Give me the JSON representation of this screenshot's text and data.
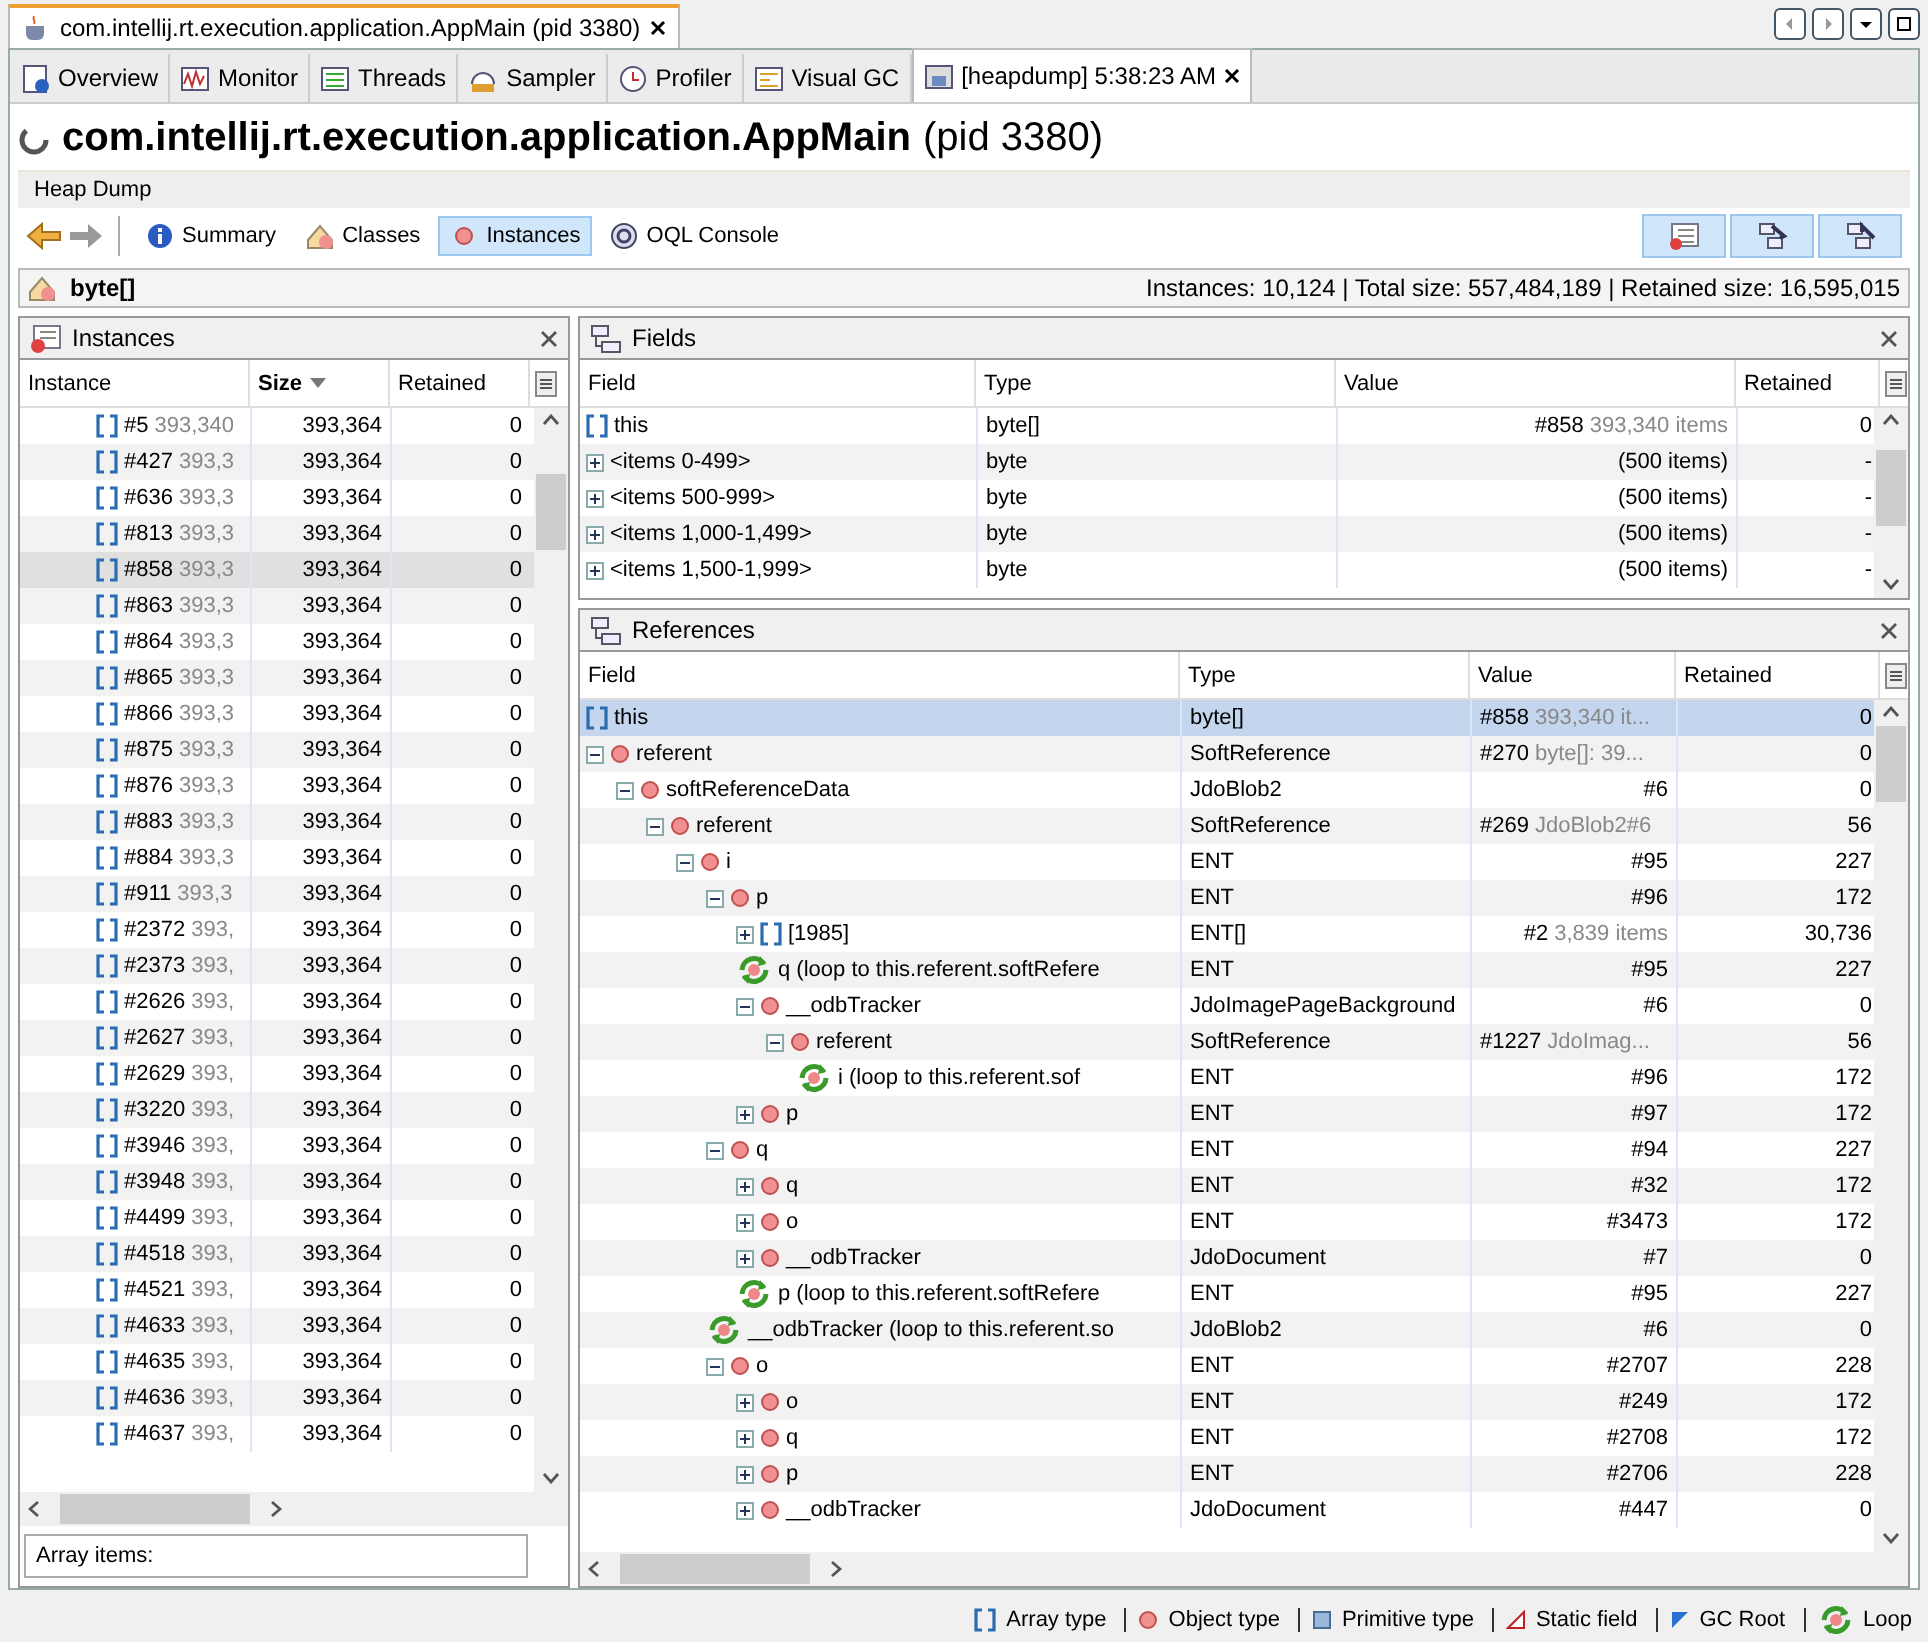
{
  "document_tab": {
    "title": "com.intellij.rt.execution.application.AppMain (pid 3380)",
    "selected": true
  },
  "tabs": [
    {
      "label": "Overview",
      "selected": false,
      "closable": false
    },
    {
      "label": "Monitor",
      "selected": false,
      "closable": false
    },
    {
      "label": "Threads",
      "selected": false,
      "closable": false
    },
    {
      "label": "Sampler",
      "selected": false,
      "closable": false
    },
    {
      "label": "Profiler",
      "selected": false,
      "closable": false
    },
    {
      "label": "Visual GC",
      "selected": false,
      "closable": false
    },
    {
      "label": "[heapdump] 5:38:23 AM",
      "selected": true,
      "closable": true
    }
  ],
  "heading": {
    "name": "com.intellij.rt.execution.application.AppMain",
    "pid": "(pid 3380)"
  },
  "view_label": "Heap Dump",
  "toolbar": [
    {
      "label": "Summary",
      "selected": false
    },
    {
      "label": "Classes",
      "selected": false
    },
    {
      "label": "Instances",
      "selected": true
    },
    {
      "label": "OQL Console",
      "selected": false
    }
  ],
  "class_bar": {
    "name": "byte[]",
    "stats": "Instances: 10,124  |  Total size: 557,484,189  |  Retained size: 16,595,015"
  },
  "instances": {
    "title": "Instances",
    "columns": [
      {
        "label": "Instance",
        "sorted": false
      },
      {
        "label": "Size",
        "sorted": true
      },
      {
        "label": "Retained",
        "sorted": false
      }
    ],
    "rows": [
      {
        "instance": "#5",
        "hint": "393,340",
        "size": "393,364",
        "retained": "0",
        "selected": false
      },
      {
        "instance": "#427",
        "hint": "393,3",
        "size": "393,364",
        "retained": "0",
        "selected": false
      },
      {
        "instance": "#636",
        "hint": "393,3",
        "size": "393,364",
        "retained": "0",
        "selected": false
      },
      {
        "instance": "#813",
        "hint": "393,3",
        "size": "393,364",
        "retained": "0",
        "selected": false
      },
      {
        "instance": "#858",
        "hint": "393,3",
        "size": "393,364",
        "retained": "0",
        "selected": true
      },
      {
        "instance": "#863",
        "hint": "393,3",
        "size": "393,364",
        "retained": "0",
        "selected": false
      },
      {
        "instance": "#864",
        "hint": "393,3",
        "size": "393,364",
        "retained": "0",
        "selected": false
      },
      {
        "instance": "#865",
        "hint": "393,3",
        "size": "393,364",
        "retained": "0",
        "selected": false
      },
      {
        "instance": "#866",
        "hint": "393,3",
        "size": "393,364",
        "retained": "0",
        "selected": false
      },
      {
        "instance": "#875",
        "hint": "393,3",
        "size": "393,364",
        "retained": "0",
        "selected": false
      },
      {
        "instance": "#876",
        "hint": "393,3",
        "size": "393,364",
        "retained": "0",
        "selected": false
      },
      {
        "instance": "#883",
        "hint": "393,3",
        "size": "393,364",
        "retained": "0",
        "selected": false
      },
      {
        "instance": "#884",
        "hint": "393,3",
        "size": "393,364",
        "retained": "0",
        "selected": false
      },
      {
        "instance": "#911",
        "hint": "393,3",
        "size": "393,364",
        "retained": "0",
        "selected": false
      },
      {
        "instance": "#2372",
        "hint": "393,",
        "size": "393,364",
        "retained": "0",
        "selected": false
      },
      {
        "instance": "#2373",
        "hint": "393,",
        "size": "393,364",
        "retained": "0",
        "selected": false
      },
      {
        "instance": "#2626",
        "hint": "393,",
        "size": "393,364",
        "retained": "0",
        "selected": false
      },
      {
        "instance": "#2627",
        "hint": "393,",
        "size": "393,364",
        "retained": "0",
        "selected": false
      },
      {
        "instance": "#2629",
        "hint": "393,",
        "size": "393,364",
        "retained": "0",
        "selected": false
      },
      {
        "instance": "#3220",
        "hint": "393,",
        "size": "393,364",
        "retained": "0",
        "selected": false
      },
      {
        "instance": "#3946",
        "hint": "393,",
        "size": "393,364",
        "retained": "0",
        "selected": false
      },
      {
        "instance": "#3948",
        "hint": "393,",
        "size": "393,364",
        "retained": "0",
        "selected": false
      },
      {
        "instance": "#4499",
        "hint": "393,",
        "size": "393,364",
        "retained": "0",
        "selected": false
      },
      {
        "instance": "#4518",
        "hint": "393,",
        "size": "393,364",
        "retained": "0",
        "selected": false
      },
      {
        "instance": "#4521",
        "hint": "393,",
        "size": "393,364",
        "retained": "0",
        "selected": false
      },
      {
        "instance": "#4633",
        "hint": "393,",
        "size": "393,364",
        "retained": "0",
        "selected": false
      },
      {
        "instance": "#4635",
        "hint": "393,",
        "size": "393,364",
        "retained": "0",
        "selected": false
      },
      {
        "instance": "#4636",
        "hint": "393,",
        "size": "393,364",
        "retained": "0",
        "selected": false
      },
      {
        "instance": "#4637",
        "hint": "393,",
        "size": "393,364",
        "retained": "0",
        "selected": false
      }
    ],
    "details": "Array items:"
  },
  "fields": {
    "title": "Fields",
    "columns": [
      "Field",
      "Type",
      "Value",
      "Retained"
    ],
    "rows": [
      {
        "kind": "array",
        "field": "this",
        "type": "byte[]",
        "value": "#858",
        "hint": "393,340 items",
        "retained": "0"
      },
      {
        "kind": "group",
        "expanded": false,
        "field": "<items 0-499>",
        "type": "byte",
        "value": "(500 items)",
        "retained": "-"
      },
      {
        "kind": "group",
        "expanded": false,
        "field": "<items 500-999>",
        "type": "byte",
        "value": "(500 items)",
        "retained": "-"
      },
      {
        "kind": "group",
        "expanded": false,
        "field": "<items 1,000-1,499>",
        "type": "byte",
        "value": "(500 items)",
        "retained": "-"
      },
      {
        "kind": "group",
        "expanded": false,
        "field": "<items 1,500-1,999>",
        "type": "byte",
        "value": "(500 items)",
        "retained": "-"
      }
    ]
  },
  "references": {
    "title": "References",
    "columns": [
      "Field",
      "Type",
      "Value",
      "Retained"
    ],
    "rows": [
      {
        "kind": "array",
        "field": "this",
        "type": "byte[]",
        "value": "#858",
        "hint": "393,340 it...",
        "retained": "0",
        "selected": true
      },
      {
        "kind": "object",
        "field": "referent",
        "type": "SoftReference",
        "value": "#270",
        "hint": "byte[]: 39...",
        "retained": "0",
        "selected": false,
        "expanded": true,
        "children": [
          {
            "kind": "object",
            "field": "softReferenceData",
            "type": "JdoBlob2",
            "value": "#6",
            "retained": "0",
            "selected": false,
            "expanded": true,
            "children": [
              {
                "kind": "object",
                "field": "referent",
                "type": "SoftReference",
                "value": "#269",
                "hint": "JdoBlob2#6",
                "retained": "56",
                "selected": false,
                "expanded": true,
                "children": [
                  {
                    "kind": "object",
                    "field": "i",
                    "type": "ENT",
                    "value": "#95",
                    "retained": "227",
                    "selected": false,
                    "expanded": true,
                    "children": [
                      {
                        "kind": "object",
                        "field": "p",
                        "type": "ENT",
                        "value": "#96",
                        "retained": "172",
                        "selected": false,
                        "expanded": true,
                        "children": [
                          {
                            "kind": "array",
                            "field": "[1985]",
                            "type": "ENT[]",
                            "value": "#2",
                            "hint": "3,839 items",
                            "retained": "30,736",
                            "selected": false,
                            "expanded": false
                          },
                          {
                            "kind": "loop",
                            "field": "q (loop to this.referent.softRefere",
                            "type": "ENT",
                            "value": "#95",
                            "retained": "227",
                            "selected": false
                          },
                          {
                            "kind": "object",
                            "field": "__odbTracker",
                            "type": "JdoImagePageBackground",
                            "value": "#6",
                            "retained": "0",
                            "selected": false,
                            "expanded": true,
                            "children": [
                              {
                                "kind": "object",
                                "field": "referent",
                                "type": "SoftReference",
                                "value": "#1227",
                                "hint": "JdoImag...",
                                "retained": "56",
                                "selected": false,
                                "expanded": true,
                                "children": [
                                  {
                                    "kind": "loop",
                                    "field": "i (loop to this.referent.sof",
                                    "type": "ENT",
                                    "value": "#96",
                                    "retained": "172",
                                    "selected": false
                                  }
                                ]
                              }
                            ]
                          },
                          {
                            "kind": "object",
                            "field": "p",
                            "type": "ENT",
                            "value": "#97",
                            "retained": "172",
                            "selected": false,
                            "expanded": false
                          }
                        ]
                      },
                      {
                        "kind": "object",
                        "field": "q",
                        "type": "ENT",
                        "value": "#94",
                        "retained": "227",
                        "selected": false,
                        "expanded": true,
                        "children": [
                          {
                            "kind": "object",
                            "field": "q",
                            "type": "ENT",
                            "value": "#32",
                            "retained": "172",
                            "selected": false,
                            "expanded": false
                          },
                          {
                            "kind": "object",
                            "field": "o",
                            "type": "ENT",
                            "value": "#3473",
                            "retained": "172",
                            "selected": false,
                            "expanded": false
                          },
                          {
                            "kind": "object",
                            "field": "__odbTracker",
                            "type": "JdoDocument",
                            "value": "#7",
                            "retained": "0",
                            "selected": false,
                            "expanded": false
                          },
                          {
                            "kind": "loop",
                            "field": "p (loop to this.referent.softRefere",
                            "type": "ENT",
                            "value": "#95",
                            "retained": "227",
                            "selected": false
                          }
                        ]
                      },
                      {
                        "kind": "loop",
                        "field": "__odbTracker (loop to this.referent.so",
                        "type": "JdoBlob2",
                        "value": "#6",
                        "retained": "0",
                        "selected": false
                      },
                      {
                        "kind": "object",
                        "field": "o",
                        "type": "ENT",
                        "value": "#2707",
                        "retained": "228",
                        "selected": false,
                        "expanded": true,
                        "children": [
                          {
                            "kind": "object",
                            "field": "o",
                            "type": "ENT",
                            "value": "#249",
                            "retained": "172",
                            "selected": false,
                            "expanded": false
                          },
                          {
                            "kind": "object",
                            "field": "q",
                            "type": "ENT",
                            "value": "#2708",
                            "retained": "172",
                            "selected": false,
                            "expanded": false
                          },
                          {
                            "kind": "object",
                            "field": "p",
                            "type": "ENT",
                            "value": "#2706",
                            "retained": "228",
                            "selected": false,
                            "expanded": false
                          },
                          {
                            "kind": "object",
                            "field": "__odbTracker",
                            "type": "JdoDocument",
                            "value": "#447",
                            "retained": "0",
                            "selected": false,
                            "expanded": false
                          }
                        ]
                      }
                    ]
                  }
                ]
              }
            ]
          }
        ]
      }
    ]
  },
  "legend": [
    {
      "kind": "array",
      "label": "Array type"
    },
    {
      "kind": "object",
      "label": "Object type"
    },
    {
      "kind": "primitive",
      "label": "Primitive type"
    },
    {
      "kind": "static",
      "label": "Static field"
    },
    {
      "kind": "gcroot",
      "label": "GC Root"
    },
    {
      "kind": "loop",
      "label": "Loop"
    }
  ]
}
